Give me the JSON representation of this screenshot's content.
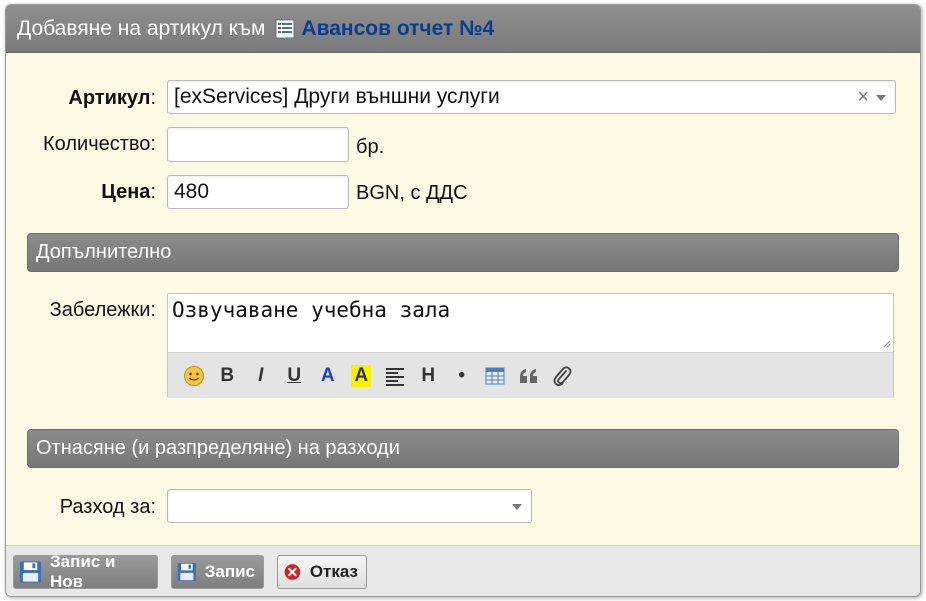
{
  "dialog": {
    "title_prefix": "Добавяне на артикул към",
    "doc_link": "Авансов отчет №4"
  },
  "form": {
    "article_label": "Артикул",
    "article_value": "[exServices] Други външни услуги",
    "quantity_label": "Количество:",
    "quantity_value": "",
    "quantity_unit": "бр.",
    "price_label": "Цена",
    "price_value": "480",
    "price_unit": "BGN, с ДДС",
    "colon": ":"
  },
  "sections": {
    "additional": "Допълнително",
    "expenses": "Отнасяне (и разпределяне) на разходи"
  },
  "notes": {
    "label": "Забележки:",
    "value": "Озвучаване учебна зала",
    "toolbar": [
      "smiley",
      "bold",
      "italic",
      "underline",
      "text-color",
      "background-color",
      "alignment",
      "heading",
      "list",
      "table",
      "quote",
      "attachment"
    ],
    "toolbar_labels": {
      "bold": "B",
      "italic": "I",
      "underline": "U",
      "text_color": "A",
      "bg_color": "A",
      "heading": "H",
      "list": "•"
    }
  },
  "expense": {
    "label": "Разход за:",
    "value": ""
  },
  "buttons": {
    "save_new": "Запис и Нов",
    "save": "Запис",
    "cancel": "Отказ"
  },
  "colors": {
    "dialog_bg": "#fbfae4",
    "header_gray": "#7a7a7a",
    "link_blue": "#0a3d91",
    "cancel_red": "#c8262c"
  }
}
